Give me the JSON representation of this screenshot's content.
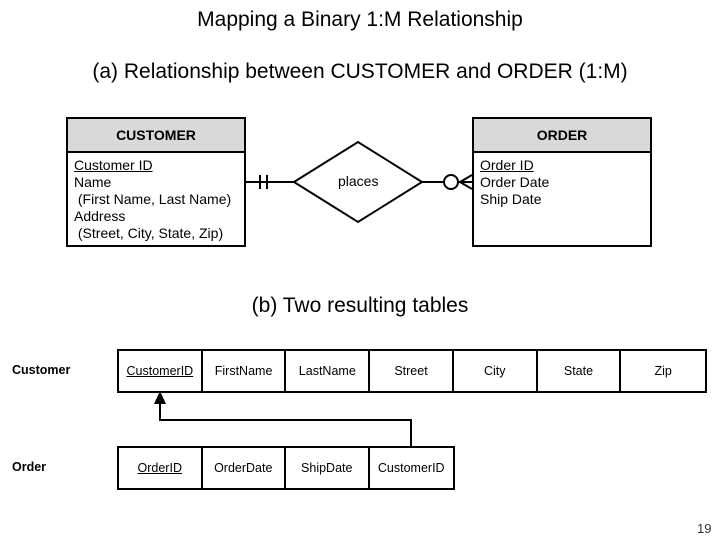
{
  "title": "Mapping a Binary 1:M Relationship",
  "section_a": "(a) Relationship between CUSTOMER and ORDER (1:M)",
  "section_b": "(b) Two resulting tables",
  "erd": {
    "customer": {
      "name": "CUSTOMER",
      "attributes": [
        {
          "text": "Customer ID",
          "key": true
        },
        {
          "text": "Name",
          "key": false
        },
        {
          "text": " (First Name, Last Name)",
          "key": false
        },
        {
          "text": "Address",
          "key": false
        },
        {
          "text": " (Street, City, State, Zip)",
          "key": false
        }
      ]
    },
    "relationship": "places",
    "order": {
      "name": "ORDER",
      "attributes": [
        {
          "text": "Order ID",
          "key": true
        },
        {
          "text": "Order Date",
          "key": false
        },
        {
          "text": "Ship Date",
          "key": false
        }
      ]
    },
    "cardinality": {
      "customer_side": "one-and-only-one",
      "order_side": "zero-or-many"
    }
  },
  "tables": {
    "customer": {
      "label": "Customer",
      "columns": [
        "CustomerID",
        "FirstName",
        "LastName",
        "Street",
        "City",
        "State",
        "Zip"
      ],
      "primary_key": "CustomerID"
    },
    "order": {
      "label": "Order",
      "columns": [
        "OrderID",
        "OrderDate",
        "ShipDate",
        "CustomerID"
      ],
      "primary_key": "OrderID",
      "foreign_key": "CustomerID"
    }
  },
  "page_number": "19"
}
